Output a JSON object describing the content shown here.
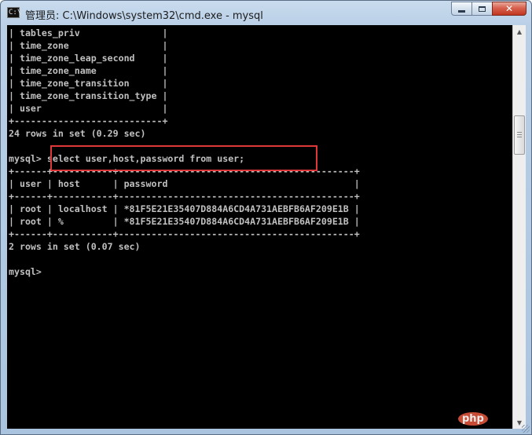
{
  "window": {
    "title": "管理员: C:\\Windows\\system32\\cmd.exe - mysql",
    "icon_label": "C:\\"
  },
  "console": {
    "lines": [
      "| tables_priv               |",
      "| time_zone                 |",
      "| time_zone_leap_second     |",
      "| time_zone_name            |",
      "| time_zone_transition      |",
      "| time_zone_transition_type |",
      "| user                      |",
      "+---------------------------+",
      "24 rows in set (0.29 sec)",
      "",
      "mysql> select user,host,password from user;",
      "+------+-----------+-------------------------------------------+",
      "| user | host      | password                                  |",
      "+------+-----------+-------------------------------------------+",
      "| root | localhost | *81F5E21E35407D884A6CD4A731AEBFB6AF209E1B |",
      "| root | %         | *81F5E21E35407D884A6CD4A731AEBFB6AF209E1B |",
      "+------+-----------+-------------------------------------------+",
      "2 rows in set (0.07 sec)",
      "",
      "mysql>"
    ],
    "highlight_color": "#e0373a"
  },
  "watermark": {
    "text": "php"
  },
  "colors": {
    "console_bg": "#000000",
    "console_fg": "#c0c0c0",
    "close_button": "#c2361f"
  }
}
